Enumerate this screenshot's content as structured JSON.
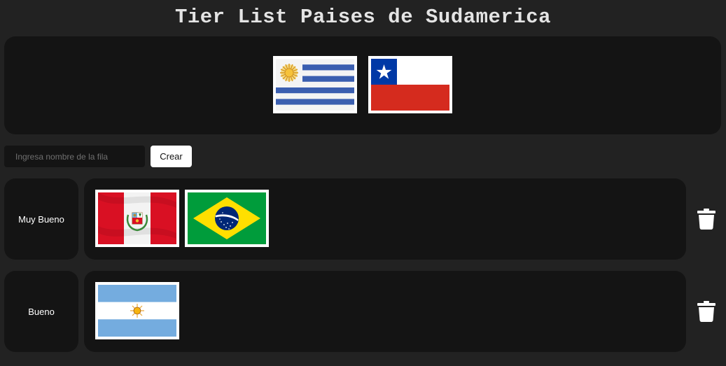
{
  "title": "Tier List Paises de Sudamerica",
  "pool": {
    "flags": [
      {
        "country": "Uruguay",
        "icon": "uruguay-flag"
      },
      {
        "country": "Chile",
        "icon": "chile-flag"
      }
    ]
  },
  "new_row": {
    "placeholder": "Ingresa nombre de la fila",
    "button_label": "Crear"
  },
  "tiers": [
    {
      "label": "Muy Bueno",
      "flags": [
        {
          "country": "Peru",
          "icon": "peru-flag"
        },
        {
          "country": "Brasil",
          "icon": "brazil-flag"
        }
      ],
      "delete_icon": "trash-icon"
    },
    {
      "label": "Bueno",
      "flags": [
        {
          "country": "Argentina",
          "icon": "argentina-flag"
        }
      ],
      "delete_icon": "trash-icon"
    }
  ],
  "colors": {
    "background": "#222222",
    "panel": "#141414",
    "title": "#e4e4e4",
    "button_bg": "#ffffff"
  }
}
